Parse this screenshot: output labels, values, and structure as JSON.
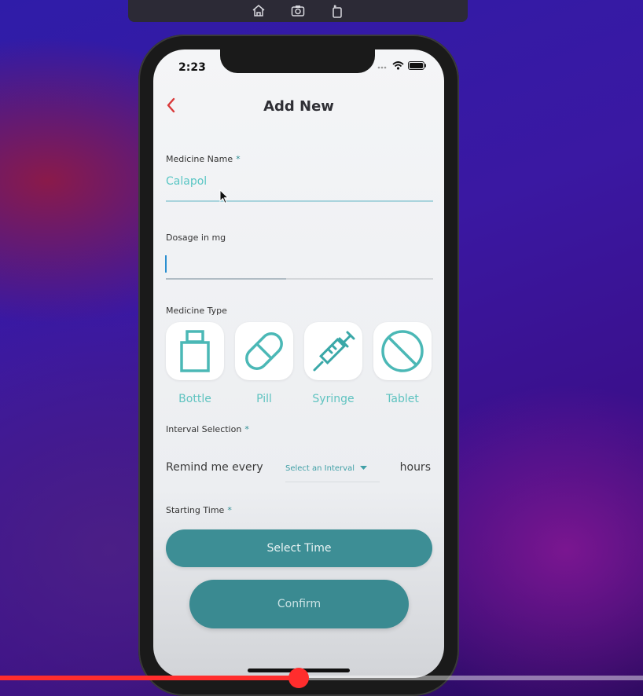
{
  "simulator_toolbar": {
    "icons": [
      "home-icon",
      "screenshot-icon",
      "rotate-icon"
    ]
  },
  "status_bar": {
    "time": "2:23",
    "icons": [
      "signal-icon",
      "wifi-icon",
      "battery-icon"
    ]
  },
  "header": {
    "back_icon": "chevron-left-icon",
    "title": "Add New"
  },
  "form": {
    "medicine_name": {
      "label": "Medicine Name",
      "required_mark": "*",
      "value": "Calapol"
    },
    "dosage": {
      "label": "Dosage in mg",
      "value": ""
    },
    "medicine_type": {
      "label": "Medicine Type",
      "options": [
        {
          "label": "Bottle",
          "icon": "bottle-icon"
        },
        {
          "label": "Pill",
          "icon": "pill-icon"
        },
        {
          "label": "Syringe",
          "icon": "syringe-icon"
        },
        {
          "label": "Tablet",
          "icon": "tablet-icon"
        }
      ]
    },
    "interval": {
      "label": "Interval Selection",
      "required_mark": "*",
      "prefix": "Remind me every",
      "select_placeholder": "Select an Interval",
      "suffix": "hours"
    },
    "starting_time": {
      "label": "Starting Time",
      "required_mark": "*",
      "button_label": "Select Time"
    },
    "confirm_label": "Confirm"
  },
  "colors": {
    "accent": "#3d8e95",
    "teal_text": "#5fc3c0",
    "back_arrow": "#d9393a",
    "progress": "#ff2d2d"
  },
  "video_progress": {
    "fraction": 0.465
  }
}
